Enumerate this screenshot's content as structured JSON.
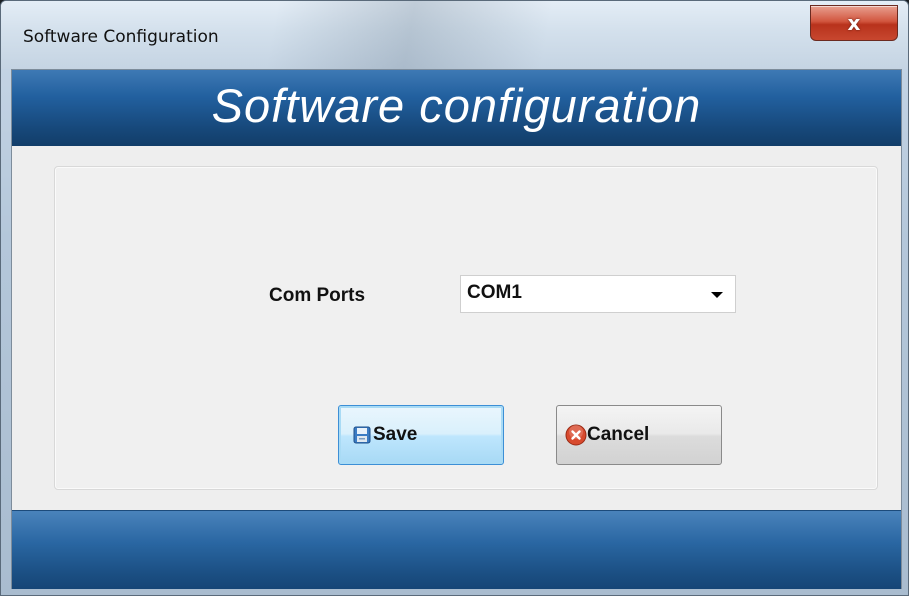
{
  "window": {
    "title": "Software Configuration",
    "close_glyph": "x"
  },
  "header": {
    "heading": "Software configuration"
  },
  "form": {
    "com_ports_label": "Com Ports",
    "com_ports_value": "COM1"
  },
  "buttons": {
    "save_label": "Save",
    "save_icon": "floppy-disk-icon",
    "cancel_label": "Cancel",
    "cancel_icon": "red-x-circle-icon"
  },
  "colors": {
    "header_band": "#22609f",
    "footer_band": "#2a67a3",
    "save_focus_border": "#3c8fd6",
    "close_button": "#c8472f"
  }
}
